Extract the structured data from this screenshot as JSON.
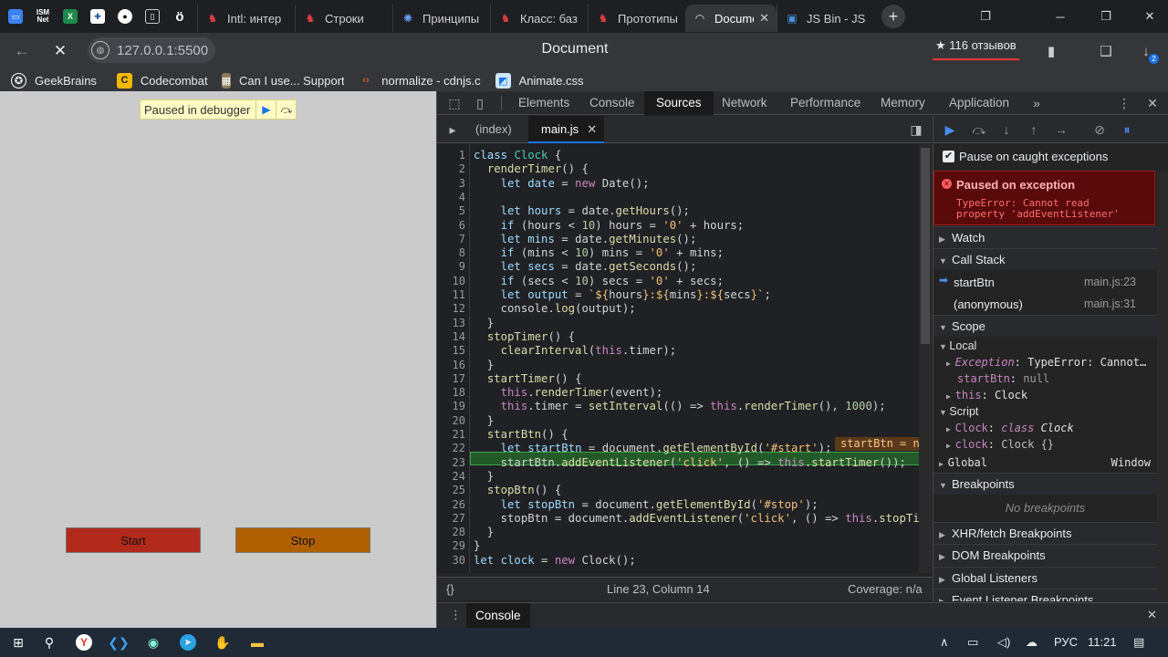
{
  "browser": {
    "pinned": [
      {
        "icon": "chat-icon",
        "text": ""
      },
      {
        "icon": "ismnet-icon",
        "text": "ISM Net"
      },
      {
        "icon": "excel-icon",
        "text": ""
      },
      {
        "icon": "finland-flag-icon",
        "text": ""
      },
      {
        "icon": "github-icon",
        "text": ""
      },
      {
        "icon": "bookmark-tab-icon",
        "text": ""
      },
      {
        "icon": "o-umlaut-icon",
        "text": "ö"
      }
    ],
    "tabs": [
      {
        "title": "Intl: интер",
        "icon": "jsbin-icon"
      },
      {
        "title": "Строки",
        "icon": "jsbin-icon"
      },
      {
        "title": "Принципы",
        "icon": "globe-tab-icon"
      },
      {
        "title": "Класс: баз",
        "icon": "jsbin-icon"
      },
      {
        "title": "Прототипы",
        "icon": "jsbin-icon"
      },
      {
        "title": "Document",
        "icon": "loading-icon",
        "active": true
      },
      {
        "title": "JS Bin - JS",
        "icon": "jsbin-icon"
      }
    ],
    "url": "127.0.0.1:5500",
    "page_title": "Document",
    "reviews": "★ 116 отзывов",
    "download_badge": "2"
  },
  "bookmarks": [
    {
      "label": "GeekBrains",
      "icon": "geekbrains-icon"
    },
    {
      "label": "Codecombat",
      "icon": "codecombat-icon"
    },
    {
      "label": "Can I use... Support",
      "icon": "caniuse-icon"
    },
    {
      "label": "normalize - cdnjs.c",
      "icon": "cdnjs-icon"
    },
    {
      "label": "Animate.css",
      "icon": "animate-icon"
    }
  ],
  "page": {
    "paused_text": "Paused in debugger",
    "start_label": "Start",
    "stop_label": "Stop",
    "colors": {
      "start": "#b22a1c",
      "stop": "#b06000",
      "background": "#cbcbcb"
    }
  },
  "devtools": {
    "tabs": [
      "Elements",
      "Console",
      "Sources",
      "Network",
      "Performance",
      "Memory",
      "Application"
    ],
    "active_tab": "Sources",
    "file_tabs": [
      "(index)",
      "main.js"
    ],
    "status": {
      "position": "Line 23, Column 14",
      "coverage": "Coverage: n/a"
    },
    "drawer_tab": "Console",
    "inline_value": "startBtn = null",
    "pause_on_caught": "Pause on caught exceptions",
    "exception": {
      "title": "Paused on exception",
      "line1": "TypeError: Cannot read",
      "line2": "property 'addEventListener'"
    },
    "sections": {
      "watch": "Watch",
      "call_stack": "Call Stack",
      "scope": "Scope",
      "breakpoints": "Breakpoints",
      "no_breakpoints": "No breakpoints",
      "xhr": "XHR/fetch Breakpoints",
      "dom": "DOM Breakpoints",
      "global_listeners": "Global Listeners",
      "event_listeners": "Event Listener Breakpoints"
    },
    "call_stack": [
      {
        "fn": "startBtn",
        "loc": "main.js:23",
        "current": true
      },
      {
        "fn": "(anonymous)",
        "loc": "main.js:31",
        "current": false
      }
    ],
    "scope": {
      "local": "Local",
      "exception_key": "Exception",
      "exception_val": "TypeError: Cannot…",
      "startbtn_key": "startBtn",
      "startbtn_val": "null",
      "this_key": "this",
      "this_val": "Clock",
      "script": "Script",
      "clock_cls_key": "Clock",
      "clock_cls_kw": "class",
      "clock_cls_val": "Clock",
      "clock_key": "clock",
      "clock_val": "Clock {}",
      "global": "Global",
      "global_val": "Window"
    }
  },
  "code": {
    "line_numbers": [
      "1",
      "2",
      "3",
      "4",
      "5",
      "6",
      "7",
      "8",
      "9",
      "10",
      "11",
      "12",
      "13",
      "14",
      "15",
      "16",
      "17",
      "18",
      "19",
      "20",
      "21",
      "22",
      "23",
      "24",
      "25",
      "26",
      "27",
      "28",
      "29",
      "30"
    ],
    "current_line": 23
  },
  "taskbar": {
    "lang": "РУС",
    "time": "11:21"
  }
}
